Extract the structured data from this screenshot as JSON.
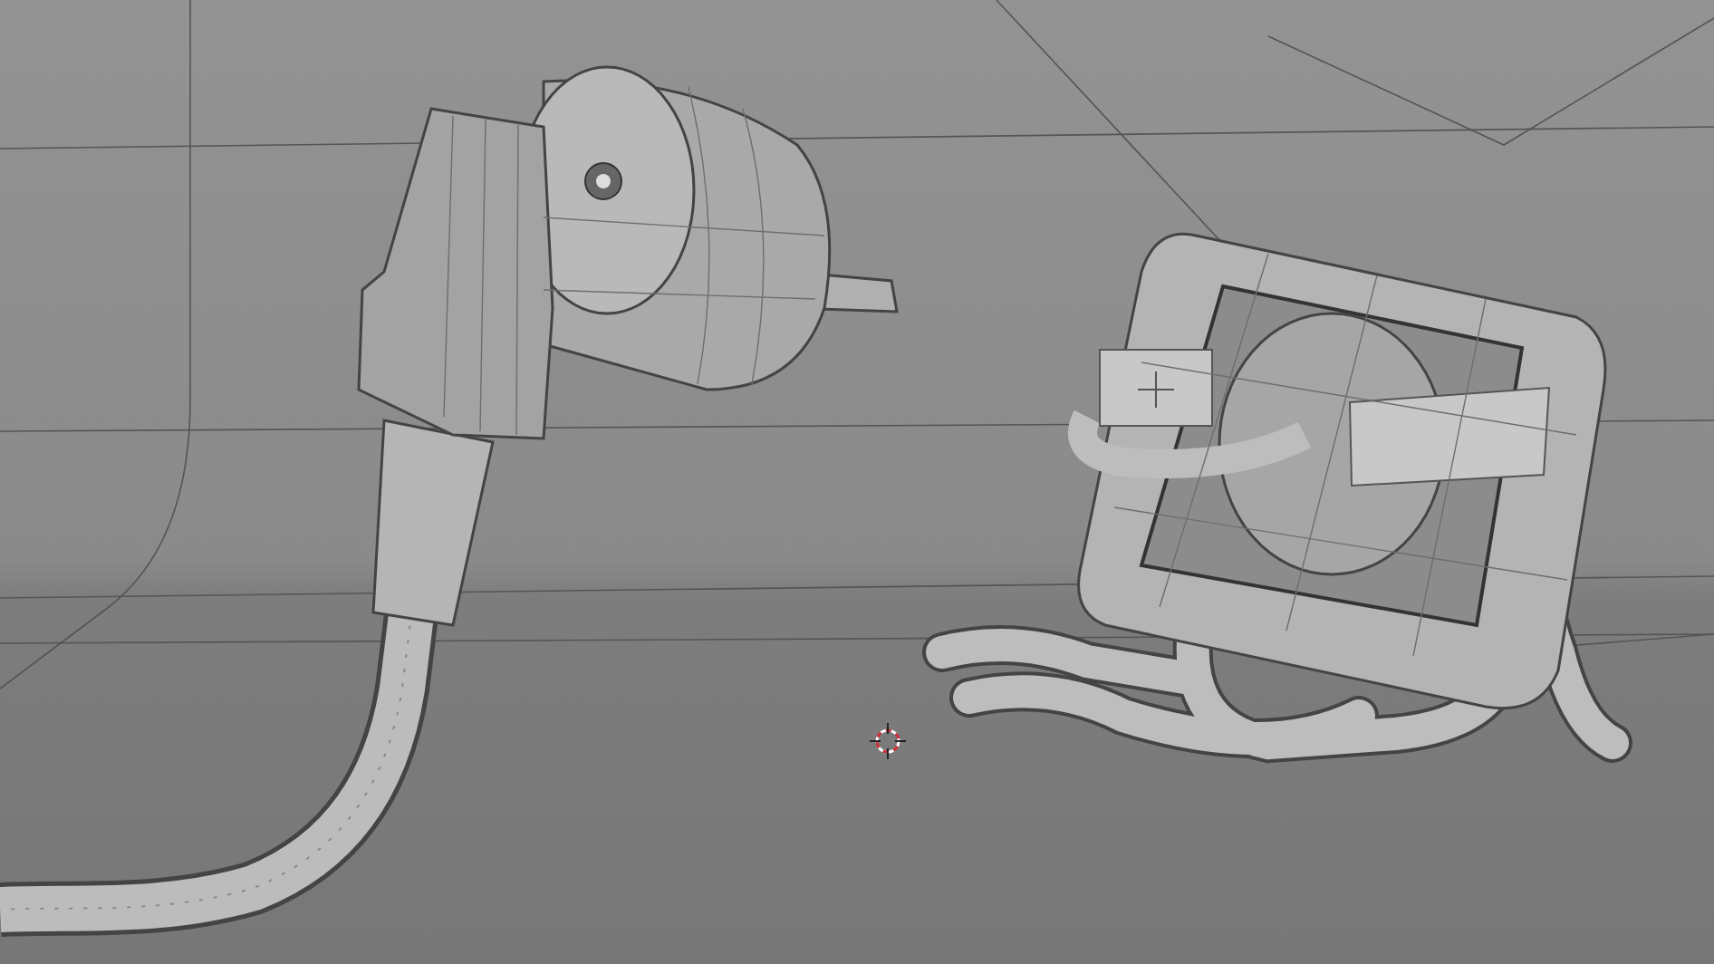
{
  "viewport": {
    "objects": [
      {
        "kind": "plug"
      },
      {
        "kind": "socket"
      },
      {
        "kind": "cursor"
      }
    ]
  }
}
